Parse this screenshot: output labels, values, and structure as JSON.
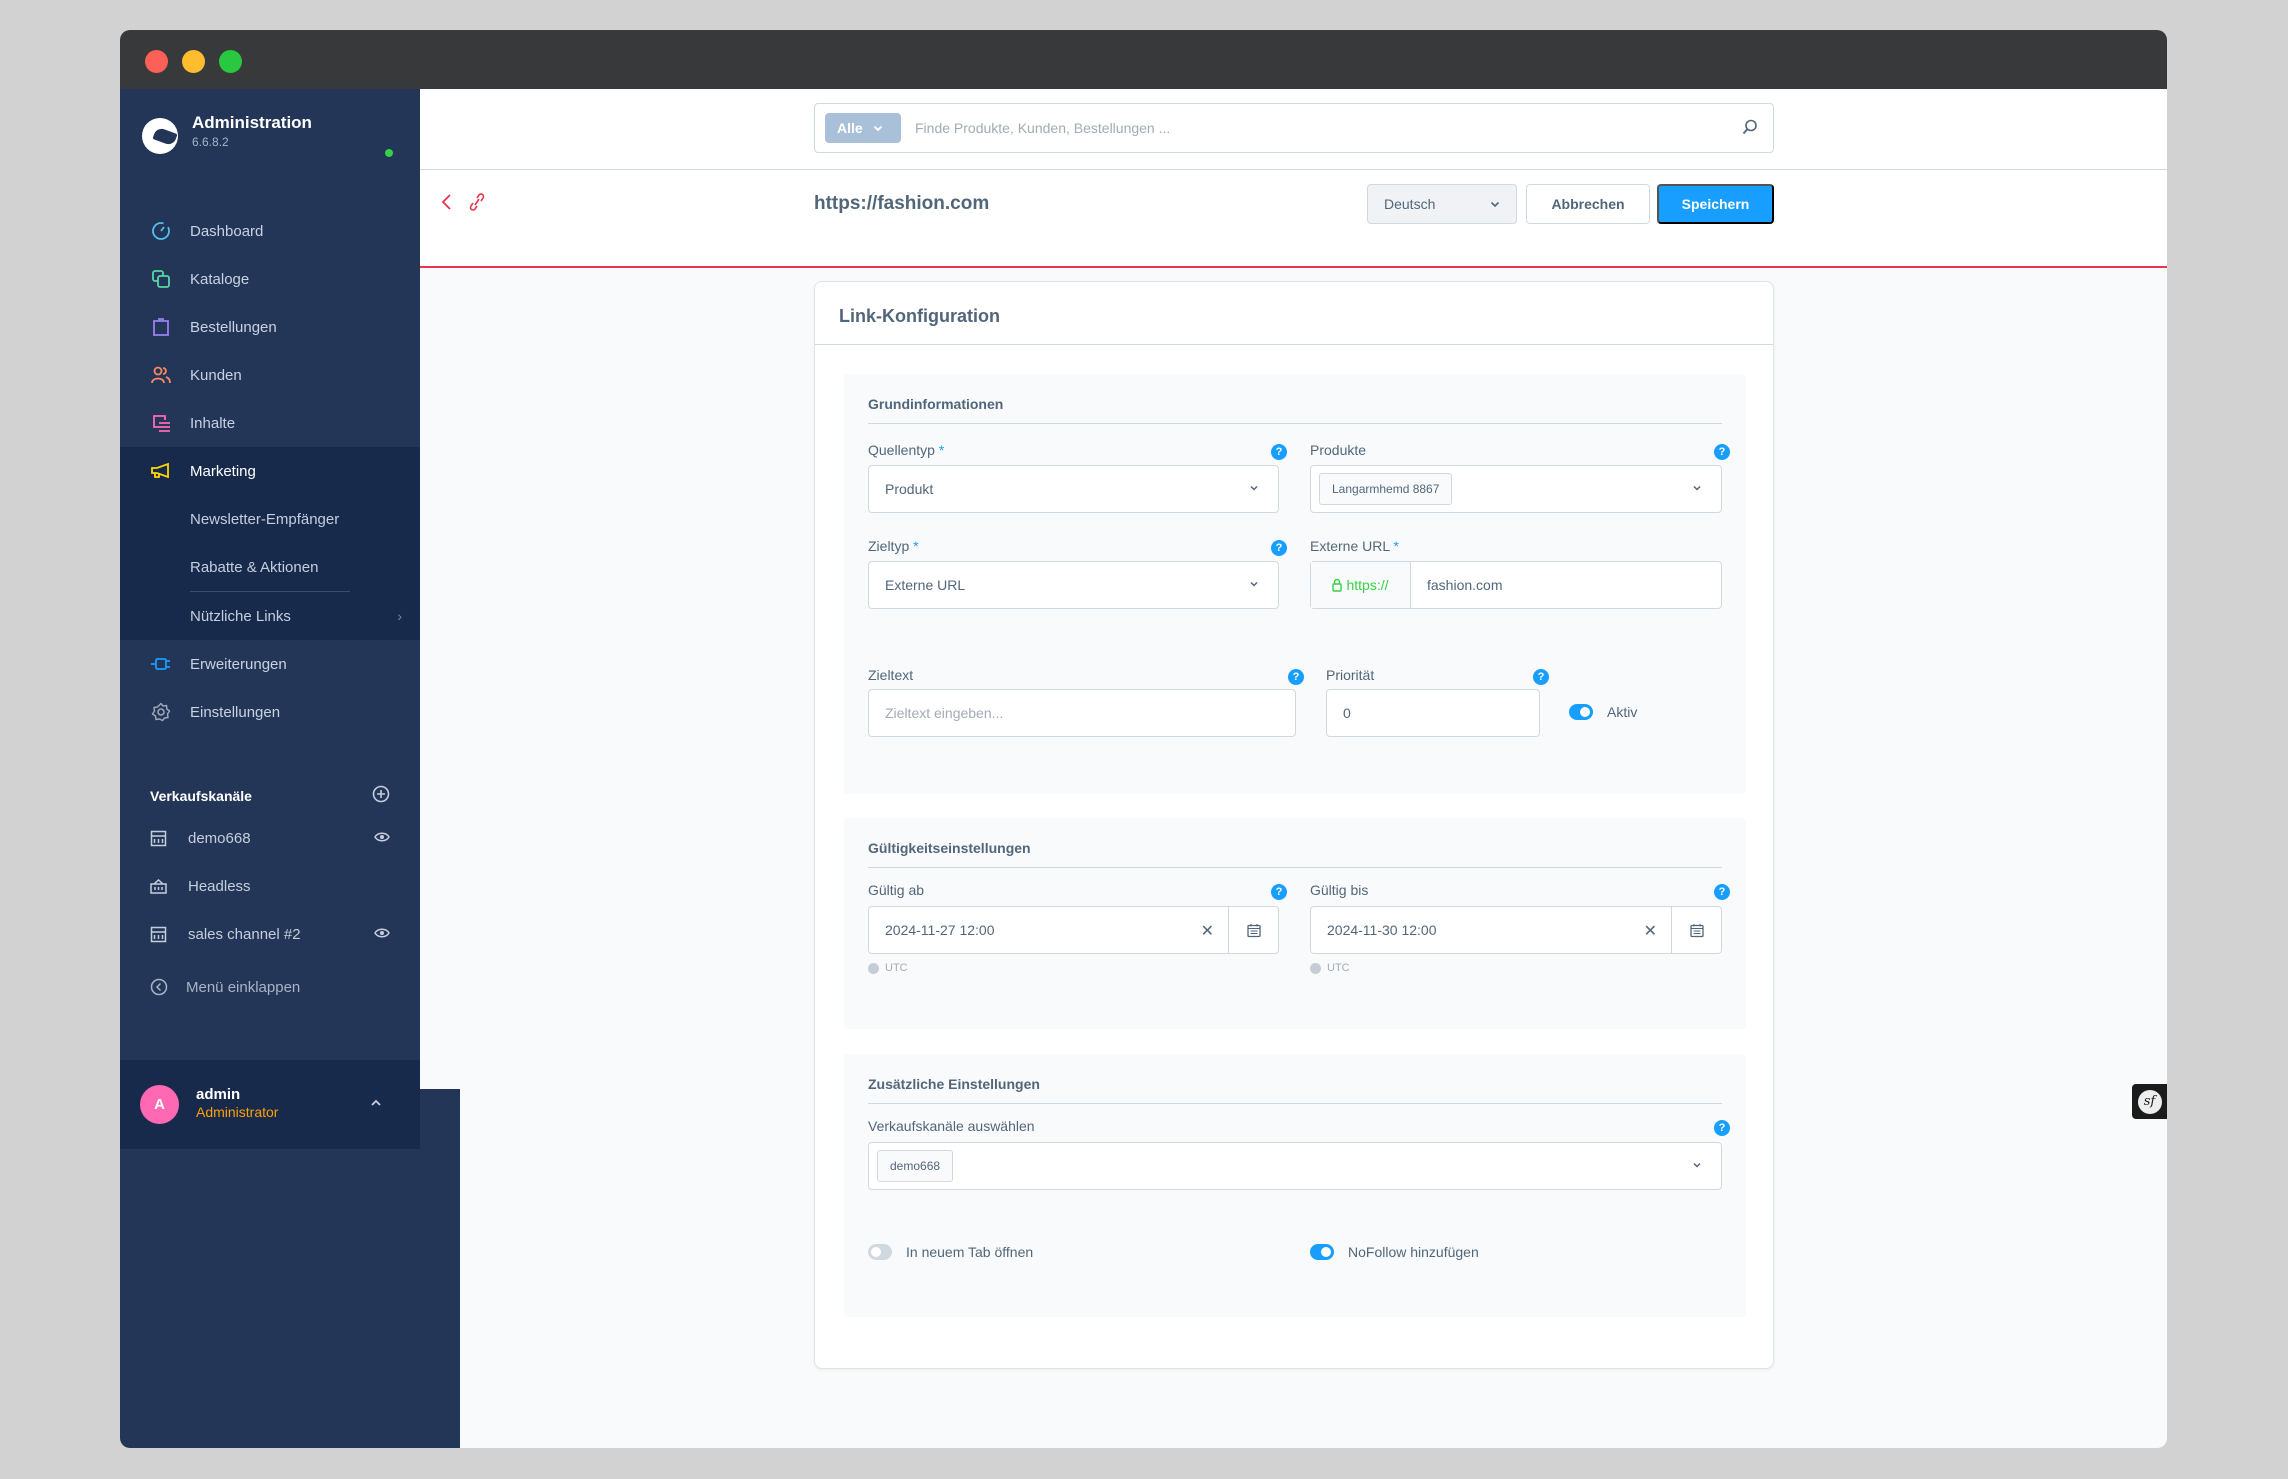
{
  "app": {
    "title": "Administration",
    "version": "6.6.8.2"
  },
  "sidebar": {
    "items": [
      {
        "label": "Dashboard",
        "icon": "dashboard-icon",
        "color": "#52c1e8"
      },
      {
        "label": "Kataloge",
        "icon": "catalog-icon",
        "color": "#57d9a3"
      },
      {
        "label": "Bestellungen",
        "icon": "orders-icon",
        "color": "#9a7ff5"
      },
      {
        "label": "Kunden",
        "icon": "customers-icon",
        "color": "#f88962"
      },
      {
        "label": "Inhalte",
        "icon": "content-icon",
        "color": "#ff68b4"
      },
      {
        "label": "Marketing",
        "icon": "megaphone-icon",
        "color": "#ffd700",
        "active": true
      },
      {
        "label": "Erweiterungen",
        "icon": "plug-icon",
        "color": "#189eff"
      },
      {
        "label": "Einstellungen",
        "icon": "gear-icon",
        "color": "#9aa8b8"
      }
    ],
    "marketing_sub": [
      {
        "label": "Newsletter-Empfänger"
      },
      {
        "label": "Rabatte & Aktionen"
      },
      {
        "label": "Nützliche Links"
      }
    ],
    "sales_channels_title": "Verkaufskanäle",
    "sales_channels": [
      {
        "label": "demo668",
        "icon": "storefront-icon",
        "visible": true
      },
      {
        "label": "Headless",
        "icon": "basket-icon",
        "visible": false
      },
      {
        "label": "sales channel #2",
        "icon": "storefront-icon",
        "visible": true
      }
    ],
    "collapse_label": "Menü einklappen",
    "user": {
      "initial": "A",
      "name": "admin",
      "role": "Administrator"
    }
  },
  "topbar": {
    "search_scope": "Alle",
    "search_placeholder": "Finde Produkte, Kunden, Bestellungen ..."
  },
  "actionbar": {
    "title": "https://fashion.com",
    "language": "Deutsch",
    "cancel_label": "Abbrechen",
    "save_label": "Speichern"
  },
  "card": {
    "title": "Link-Konfiguration",
    "basic": {
      "title": "Grundinformationen",
      "source_type_label": "Quellentyp",
      "source_type_value": "Produkt",
      "products_label": "Produkte",
      "products_tag": "Langarmhemd 8867",
      "target_type_label": "Zieltyp",
      "target_type_value": "Externe URL",
      "external_url_label": "Externe URL",
      "external_url_prefix": "https://",
      "external_url_value": "fashion.com",
      "target_text_label": "Zieltext",
      "target_text_placeholder": "Zieltext eingeben...",
      "priority_label": "Priorität",
      "priority_value": "0",
      "active_label": "Aktiv",
      "active": true
    },
    "validity": {
      "title": "Gültigkeitseinstellungen",
      "from_label": "Gültig ab",
      "from_value": "2024-11-27 12:00",
      "to_label": "Gültig bis",
      "to_value": "2024-11-30 12:00",
      "timezone": "UTC"
    },
    "additional": {
      "title": "Zusätzliche Einstellungen",
      "channels_label": "Verkaufskanäle auswählen",
      "channels_tag": "demo668",
      "new_tab_label": "In neuem Tab öffnen",
      "new_tab": false,
      "nofollow_label": "NoFollow hinzufügen",
      "nofollow": true
    }
  },
  "colors": {
    "accent": "#189eff",
    "sidebar": "#243657",
    "danger": "#e8344d",
    "user_role": "#ffa000"
  }
}
